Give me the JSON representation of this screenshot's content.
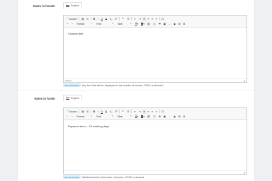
{
  "header_field": {
    "label": "Notes in header",
    "lang": "English",
    "content": "Custom text",
    "status_left": "body  p",
    "help_badge": "Use shortcodes",
    "help_text": "Any text that will be displayed in the header of invoice. HTML is allowed."
  },
  "footer_field": {
    "label": "Notes in footer",
    "lang": "English",
    "content": "Payment term – 10 working days",
    "status_left": "",
    "help_badge": "Use shortcodes",
    "help_text": "Additional text to the footer of invoice. HTML is allowed."
  },
  "toolbar": {
    "source": "Source",
    "bold": "B",
    "italic": "I",
    "underline": "U",
    "strike": "S",
    "sub": "X₂",
    "sup": "X²",
    "format": "Format",
    "font": "Font",
    "size": "Size",
    "text_color": "A",
    "bg_color": "A",
    "omega": "Ω"
  }
}
